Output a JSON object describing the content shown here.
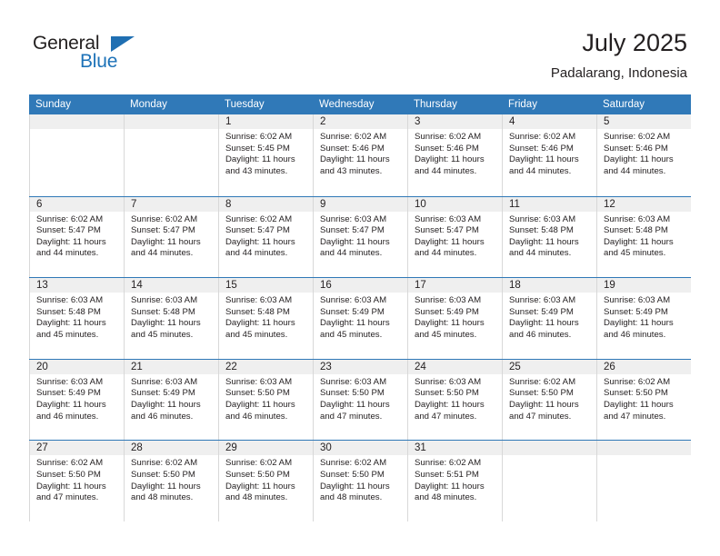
{
  "brand": {
    "name_part1": "General",
    "name_part2": "Blue",
    "logo_icon": "triangle-logo-icon",
    "accent_color": "#1f6fb2"
  },
  "header": {
    "title": "July 2025",
    "subtitle": "Padalarang, Indonesia"
  },
  "colors": {
    "header_row_bg": "#3079b8",
    "daynum_band_bg": "#efefef",
    "grid_line": "#d8d8d8",
    "week_separator": "#2f78b7",
    "text": "#231f20"
  },
  "calendar": {
    "day_headers": [
      "Sunday",
      "Monday",
      "Tuesday",
      "Wednesday",
      "Thursday",
      "Friday",
      "Saturday"
    ],
    "weeks": [
      [
        {
          "day": "",
          "sunrise": "",
          "sunset": "",
          "daylight": ""
        },
        {
          "day": "",
          "sunrise": "",
          "sunset": "",
          "daylight": ""
        },
        {
          "day": "1",
          "sunrise": "Sunrise: 6:02 AM",
          "sunset": "Sunset: 5:45 PM",
          "daylight": "Daylight: 11 hours and 43 minutes."
        },
        {
          "day": "2",
          "sunrise": "Sunrise: 6:02 AM",
          "sunset": "Sunset: 5:46 PM",
          "daylight": "Daylight: 11 hours and 43 minutes."
        },
        {
          "day": "3",
          "sunrise": "Sunrise: 6:02 AM",
          "sunset": "Sunset: 5:46 PM",
          "daylight": "Daylight: 11 hours and 44 minutes."
        },
        {
          "day": "4",
          "sunrise": "Sunrise: 6:02 AM",
          "sunset": "Sunset: 5:46 PM",
          "daylight": "Daylight: 11 hours and 44 minutes."
        },
        {
          "day": "5",
          "sunrise": "Sunrise: 6:02 AM",
          "sunset": "Sunset: 5:46 PM",
          "daylight": "Daylight: 11 hours and 44 minutes."
        }
      ],
      [
        {
          "day": "6",
          "sunrise": "Sunrise: 6:02 AM",
          "sunset": "Sunset: 5:47 PM",
          "daylight": "Daylight: 11 hours and 44 minutes."
        },
        {
          "day": "7",
          "sunrise": "Sunrise: 6:02 AM",
          "sunset": "Sunset: 5:47 PM",
          "daylight": "Daylight: 11 hours and 44 minutes."
        },
        {
          "day": "8",
          "sunrise": "Sunrise: 6:02 AM",
          "sunset": "Sunset: 5:47 PM",
          "daylight": "Daylight: 11 hours and 44 minutes."
        },
        {
          "day": "9",
          "sunrise": "Sunrise: 6:03 AM",
          "sunset": "Sunset: 5:47 PM",
          "daylight": "Daylight: 11 hours and 44 minutes."
        },
        {
          "day": "10",
          "sunrise": "Sunrise: 6:03 AM",
          "sunset": "Sunset: 5:47 PM",
          "daylight": "Daylight: 11 hours and 44 minutes."
        },
        {
          "day": "11",
          "sunrise": "Sunrise: 6:03 AM",
          "sunset": "Sunset: 5:48 PM",
          "daylight": "Daylight: 11 hours and 44 minutes."
        },
        {
          "day": "12",
          "sunrise": "Sunrise: 6:03 AM",
          "sunset": "Sunset: 5:48 PM",
          "daylight": "Daylight: 11 hours and 45 minutes."
        }
      ],
      [
        {
          "day": "13",
          "sunrise": "Sunrise: 6:03 AM",
          "sunset": "Sunset: 5:48 PM",
          "daylight": "Daylight: 11 hours and 45 minutes."
        },
        {
          "day": "14",
          "sunrise": "Sunrise: 6:03 AM",
          "sunset": "Sunset: 5:48 PM",
          "daylight": "Daylight: 11 hours and 45 minutes."
        },
        {
          "day": "15",
          "sunrise": "Sunrise: 6:03 AM",
          "sunset": "Sunset: 5:48 PM",
          "daylight": "Daylight: 11 hours and 45 minutes."
        },
        {
          "day": "16",
          "sunrise": "Sunrise: 6:03 AM",
          "sunset": "Sunset: 5:49 PM",
          "daylight": "Daylight: 11 hours and 45 minutes."
        },
        {
          "day": "17",
          "sunrise": "Sunrise: 6:03 AM",
          "sunset": "Sunset: 5:49 PM",
          "daylight": "Daylight: 11 hours and 45 minutes."
        },
        {
          "day": "18",
          "sunrise": "Sunrise: 6:03 AM",
          "sunset": "Sunset: 5:49 PM",
          "daylight": "Daylight: 11 hours and 46 minutes."
        },
        {
          "day": "19",
          "sunrise": "Sunrise: 6:03 AM",
          "sunset": "Sunset: 5:49 PM",
          "daylight": "Daylight: 11 hours and 46 minutes."
        }
      ],
      [
        {
          "day": "20",
          "sunrise": "Sunrise: 6:03 AM",
          "sunset": "Sunset: 5:49 PM",
          "daylight": "Daylight: 11 hours and 46 minutes."
        },
        {
          "day": "21",
          "sunrise": "Sunrise: 6:03 AM",
          "sunset": "Sunset: 5:49 PM",
          "daylight": "Daylight: 11 hours and 46 minutes."
        },
        {
          "day": "22",
          "sunrise": "Sunrise: 6:03 AM",
          "sunset": "Sunset: 5:50 PM",
          "daylight": "Daylight: 11 hours and 46 minutes."
        },
        {
          "day": "23",
          "sunrise": "Sunrise: 6:03 AM",
          "sunset": "Sunset: 5:50 PM",
          "daylight": "Daylight: 11 hours and 47 minutes."
        },
        {
          "day": "24",
          "sunrise": "Sunrise: 6:03 AM",
          "sunset": "Sunset: 5:50 PM",
          "daylight": "Daylight: 11 hours and 47 minutes."
        },
        {
          "day": "25",
          "sunrise": "Sunrise: 6:02 AM",
          "sunset": "Sunset: 5:50 PM",
          "daylight": "Daylight: 11 hours and 47 minutes."
        },
        {
          "day": "26",
          "sunrise": "Sunrise: 6:02 AM",
          "sunset": "Sunset: 5:50 PM",
          "daylight": "Daylight: 11 hours and 47 minutes."
        }
      ],
      [
        {
          "day": "27",
          "sunrise": "Sunrise: 6:02 AM",
          "sunset": "Sunset: 5:50 PM",
          "daylight": "Daylight: 11 hours and 47 minutes."
        },
        {
          "day": "28",
          "sunrise": "Sunrise: 6:02 AM",
          "sunset": "Sunset: 5:50 PM",
          "daylight": "Daylight: 11 hours and 48 minutes."
        },
        {
          "day": "29",
          "sunrise": "Sunrise: 6:02 AM",
          "sunset": "Sunset: 5:50 PM",
          "daylight": "Daylight: 11 hours and 48 minutes."
        },
        {
          "day": "30",
          "sunrise": "Sunrise: 6:02 AM",
          "sunset": "Sunset: 5:50 PM",
          "daylight": "Daylight: 11 hours and 48 minutes."
        },
        {
          "day": "31",
          "sunrise": "Sunrise: 6:02 AM",
          "sunset": "Sunset: 5:51 PM",
          "daylight": "Daylight: 11 hours and 48 minutes."
        },
        {
          "day": "",
          "sunrise": "",
          "sunset": "",
          "daylight": ""
        },
        {
          "day": "",
          "sunrise": "",
          "sunset": "",
          "daylight": ""
        }
      ]
    ]
  }
}
